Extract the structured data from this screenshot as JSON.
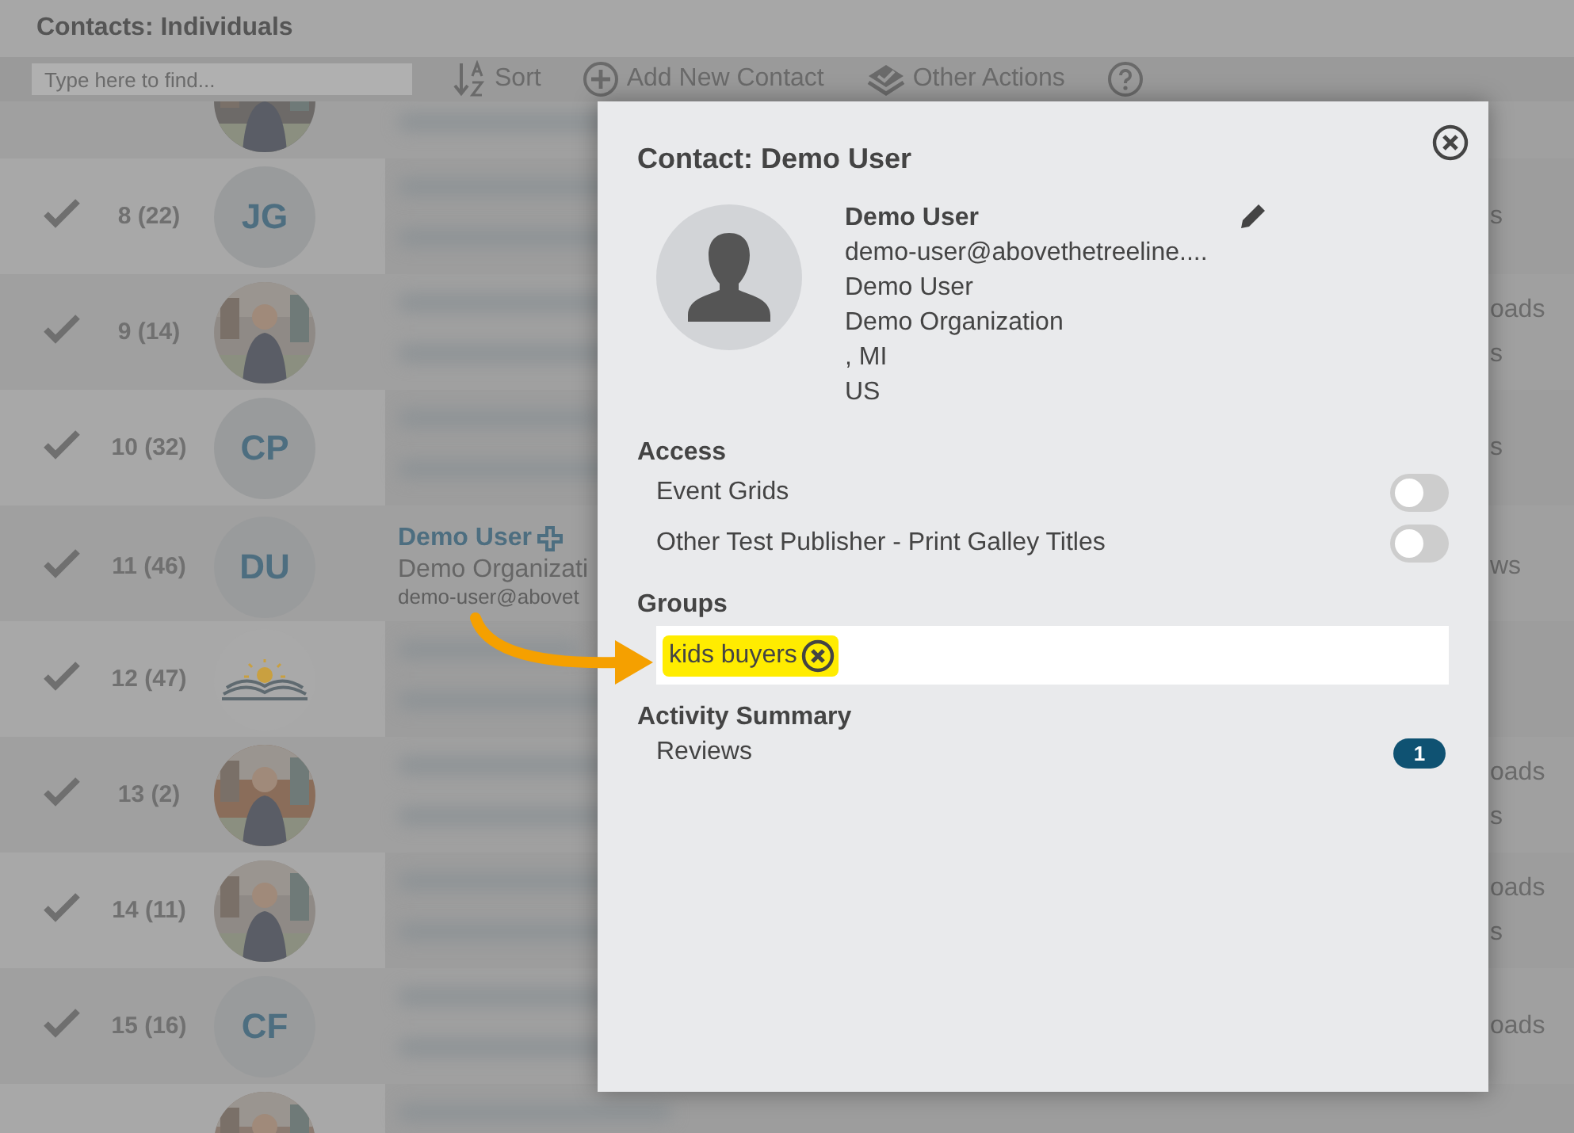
{
  "header": {
    "title": "Contacts: Individuals"
  },
  "toolbar": {
    "search": {
      "placeholder": "Type here to find..."
    },
    "actions": [
      {
        "kind": "sort",
        "label": "Sort"
      },
      {
        "kind": "add",
        "label": "Add New Contact"
      },
      {
        "kind": "other",
        "label": "Other Actions"
      },
      {
        "kind": "help"
      }
    ]
  },
  "rows": [
    {
      "avatar": {
        "kind": "picture"
      }
    },
    {
      "checked": true,
      "number": "8 (22)",
      "avatar": {
        "kind": "initials",
        "text": "JG"
      },
      "right": [
        "s"
      ]
    },
    {
      "checked": true,
      "number": "9 (14)",
      "avatar": {
        "kind": "picture"
      },
      "right": [
        "oads",
        "s"
      ]
    },
    {
      "checked": true,
      "number": "10 (32)",
      "avatar": {
        "kind": "initials",
        "text": "CP"
      },
      "right": [
        "s"
      ]
    },
    {
      "checked": true,
      "number": "11 (46)",
      "avatar": {
        "kind": "initials",
        "text": "DU"
      },
      "name": "Demo User",
      "org": "Demo Organizati",
      "email": "demo-user@abovet",
      "right": [
        "ws"
      ]
    },
    {
      "checked": true,
      "number": "12 (47)",
      "avatar": {
        "kind": "logo"
      }
    },
    {
      "checked": true,
      "number": "13 (2)",
      "avatar": {
        "kind": "picture"
      },
      "right": [
        "oads",
        "s"
      ]
    },
    {
      "checked": true,
      "number": "14 (11)",
      "avatar": {
        "kind": "picture"
      },
      "right": [
        "oads",
        "s"
      ]
    },
    {
      "checked": true,
      "number": "15 (16)",
      "avatar": {
        "kind": "initials",
        "text": "CF"
      },
      "right": [
        "oads"
      ]
    },
    {
      "avatar": {
        "kind": "picture"
      }
    }
  ],
  "modal": {
    "title": "Contact: Demo User",
    "name": "Demo User",
    "email": "demo-user@abovethetreeline....",
    "details": [
      "Demo User",
      "Demo Organization",
      ", MI",
      "US"
    ],
    "access": {
      "heading": "Access",
      "items": [
        {
          "label": "Event Grids",
          "on": false
        },
        {
          "label": "Other Test Publisher - Print Galley Titles",
          "on": false
        }
      ]
    },
    "groups": {
      "heading": "Groups",
      "tags": [
        {
          "label": "kids buyers"
        }
      ]
    },
    "activity": {
      "heading": "Activity Summary",
      "items": [
        {
          "label": "Reviews",
          "count": "1"
        }
      ]
    }
  }
}
